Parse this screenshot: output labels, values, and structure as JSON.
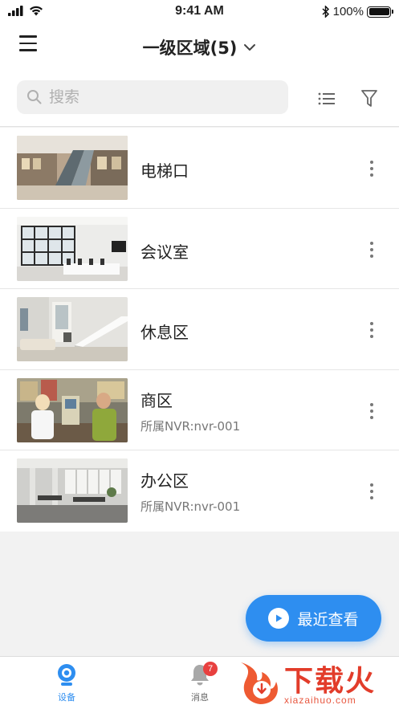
{
  "status_bar": {
    "time": "9:41 AM",
    "battery_text": "100%"
  },
  "header": {
    "title": "一级区域(5)"
  },
  "search": {
    "placeholder": "搜索"
  },
  "devices": [
    {
      "name": "电梯口",
      "nvr": ""
    },
    {
      "name": "会议室",
      "nvr": ""
    },
    {
      "name": "休息区",
      "nvr": ""
    },
    {
      "name": "商区",
      "nvr": "所属NVR:nvr-001"
    },
    {
      "name": "办公区",
      "nvr": "所属NVR:nvr-001"
    }
  ],
  "recent_button": {
    "label": "最近查看"
  },
  "tabs": [
    {
      "label": "设备",
      "icon": "camera-icon",
      "active": true
    },
    {
      "label": "消息",
      "icon": "bell-icon",
      "badge": "7"
    }
  ],
  "watermark": {
    "text": "下载火",
    "sub": "xiazaihuo.com"
  },
  "colors": {
    "accent": "#2e8ef0",
    "badge": "#e8403f",
    "watermark": "#e23c2a"
  }
}
